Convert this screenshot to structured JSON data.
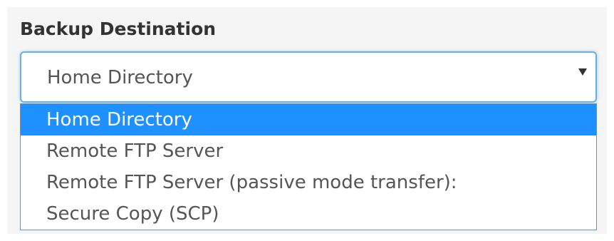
{
  "field": {
    "label": "Backup Destination"
  },
  "select": {
    "value": "Home Directory",
    "arrow_icon": "caret-down-icon",
    "focus_color": "#66afe9"
  },
  "dropdown": {
    "selected_index": 0,
    "highlight_color": "#1e90ff",
    "options": [
      {
        "label": "Home Directory"
      },
      {
        "label": "Remote FTP Server"
      },
      {
        "label": "Remote FTP Server (passive mode transfer):"
      },
      {
        "label": "Secure Copy (SCP)"
      }
    ]
  }
}
